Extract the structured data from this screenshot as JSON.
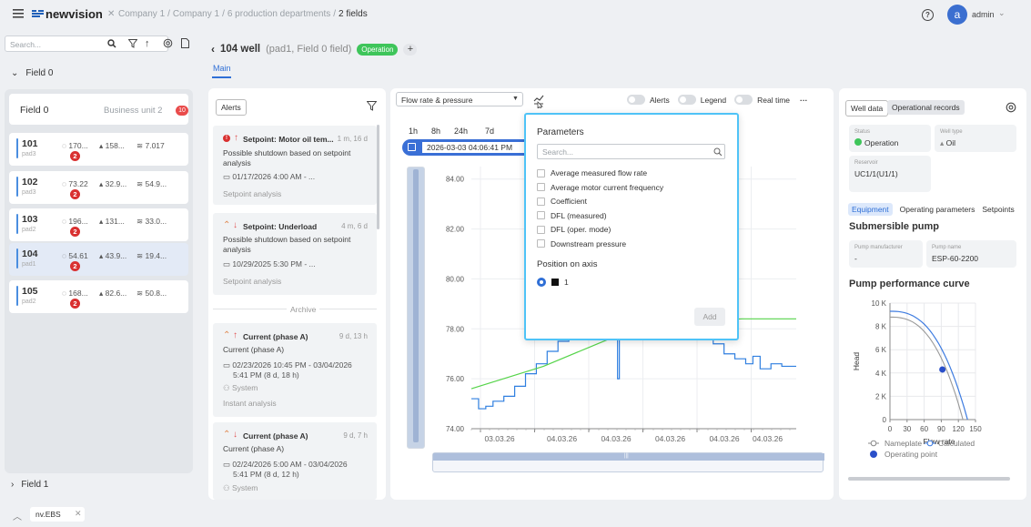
{
  "topbar": {
    "brand": "newvision",
    "breadcrumb_parts": [
      "Company 1",
      "Company 1",
      "6 production departments"
    ],
    "breadcrumb_current": "2 fields",
    "user": "admin",
    "avatar_letter": "a"
  },
  "sidebar": {
    "search_placeholder": "Search...",
    "field0_label": "Field 0",
    "field1_label": "Field 1",
    "group_title": "Field 0",
    "group_subtitle": "Business unit 2",
    "group_badge": "10",
    "wells": [
      {
        "num": "101",
        "pad": "pad3",
        "m1": "170...",
        "m2": "158...",
        "m3": "7.017",
        "err": "2"
      },
      {
        "num": "102",
        "pad": "pad3",
        "m1": "73.22",
        "m2": "32.9...",
        "m3": "54.9...",
        "err": "2"
      },
      {
        "num": "103",
        "pad": "pad2",
        "m1": "196...",
        "m2": "131...",
        "m3": "33.0...",
        "err": "2"
      },
      {
        "num": "104",
        "pad": "pad1",
        "m1": "54.61",
        "m2": "43.9...",
        "m3": "19.4...",
        "err": "2"
      },
      {
        "num": "105",
        "pad": "pad2",
        "m1": "168...",
        "m2": "82.6...",
        "m3": "50.8...",
        "err": "2"
      }
    ]
  },
  "well_header": {
    "title": "104 well",
    "subtitle": "(pad1, Field 0 field)",
    "status": "Operation",
    "tab_main": "Main"
  },
  "alerts": {
    "button": "Alerts",
    "archive_label": "Archive",
    "items": [
      {
        "title": "Setpoint: Motor oil tem...",
        "ago": "1 m, 16 d",
        "desc": "Possible shutdown based on setpoint analysis",
        "date": "01/17/2026 4:00 AM - ...",
        "source": "Setpoint analysis"
      },
      {
        "title": "Setpoint: Underload",
        "ago": "4 m, 6 d",
        "desc": "Possible shutdown based on setpoint analysis",
        "date": "10/29/2025 5:30 PM - ...",
        "source": "Setpoint analysis"
      },
      {
        "title": "Current (phase A)",
        "ago": "9 d, 13 h",
        "desc": "Current (phase A)",
        "date": "02/23/2026 10:45 PM - 03/04/2026",
        "date2": "5:41 PM  (8 d, 18 h)",
        "user": "System",
        "source": "Instant analysis"
      },
      {
        "title": "Current (phase A)",
        "ago": "9 d, 7 h",
        "desc": "Current (phase A)",
        "date": "02/24/2026 5:00 AM - 03/04/2026",
        "date2": "5:41 PM  (8 d, 12 h)",
        "user": "System"
      }
    ]
  },
  "chart_toolbar": {
    "select_value": "Flow rate & pressure",
    "alerts_label": "Alerts",
    "legend_label": "Legend",
    "realtime_label": "Real time",
    "ranges": [
      "1h",
      "8h",
      "24h",
      "7d"
    ],
    "date_value": "2026-03-03 04:06:41 PM"
  },
  "chart_data": {
    "type": "line",
    "y_ticks": [
      "84.00",
      "82.00",
      "80.00",
      "78.00",
      "76.00",
      "74.00"
    ],
    "x_ticks": [
      "03.03.26",
      "04.03.26",
      "04.03.26",
      "04.03.26",
      "04.03.26",
      "04.03.26"
    ],
    "ylim": [
      74,
      84.5
    ],
    "series": [
      {
        "color": "#2f7fe0",
        "points": [
          [
            0,
            75.2
          ],
          [
            2,
            74.8
          ],
          [
            4,
            74.9
          ],
          [
            6,
            75.1
          ],
          [
            9,
            75.3
          ],
          [
            12,
            75.7
          ],
          [
            15,
            76.2
          ],
          [
            18,
            76.6
          ],
          [
            21,
            77.1
          ],
          [
            24,
            77.5
          ],
          [
            27,
            77.9
          ],
          [
            30,
            78.3
          ],
          [
            33,
            78.7
          ],
          [
            36,
            79.2
          ],
          [
            38,
            79.6
          ],
          [
            40,
            80.0
          ],
          [
            40.5,
            76.0
          ],
          [
            41,
            78.5
          ],
          [
            45,
            79.0
          ],
          [
            50,
            79.3
          ],
          [
            55,
            79.5
          ],
          [
            60,
            79.6
          ],
          [
            62,
            79.5
          ],
          [
            64,
            77.6
          ],
          [
            67,
            77.4
          ],
          [
            70,
            77.0
          ],
          [
            73,
            76.8
          ],
          [
            76,
            76.6
          ],
          [
            78,
            76.9
          ],
          [
            80,
            76.4
          ],
          [
            83,
            76.6
          ],
          [
            86,
            76.5
          ],
          [
            90,
            76.5
          ]
        ]
      },
      {
        "color": "#56d44a",
        "points": [
          [
            0,
            75.6
          ],
          [
            20,
            76.5
          ],
          [
            35,
            77.4
          ],
          [
            45,
            78.0
          ],
          [
            60,
            78.3
          ],
          [
            75,
            78.4
          ],
          [
            90,
            78.4
          ]
        ]
      }
    ]
  },
  "params_popup": {
    "title": "Parameters",
    "search_placeholder": "Search...",
    "items": [
      "Average measured flow rate",
      "Average motor current frequency",
      "Coefficient",
      "DFL (measured)",
      "DFL (oper. mode)",
      "Downstream pressure"
    ],
    "axis_title": "Position on axis",
    "axis_value": "1",
    "add_label": "Add"
  },
  "right_panel": {
    "tab_well": "Well data",
    "tab_records": "Operational records",
    "status_label": "Status",
    "status_value": "Operation",
    "welltype_label": "Well type",
    "welltype_value": "Oil",
    "reservoir_label": "Reservoir",
    "reservoir_value": "UC1/1(U1/1)",
    "sub_tabs": [
      "Equipment",
      "Operating parameters",
      "Setpoints"
    ],
    "pump_title": "Submersible pump",
    "manufacturer_label": "Pump manufacturer",
    "manufacturer_value": "-",
    "pumpname_label": "Pump name",
    "pumpname_value": "ESP-60-2200",
    "curve_title": "Pump performance curve",
    "curve_y_ticks": [
      "10 K",
      "8 K",
      "6 K",
      "4 K",
      "2 K",
      "0"
    ],
    "curve_x_ticks": [
      "0",
      "30",
      "60",
      "90",
      "120",
      "150"
    ],
    "curve_ylabel": "Head",
    "curve_xlabel": "Flow rate",
    "legend_nameplate": "Nameplate",
    "legend_calculated": "Calculated",
    "legend_operating": "Operating point"
  },
  "bottom": {
    "tab_label": "nv.EBS"
  }
}
